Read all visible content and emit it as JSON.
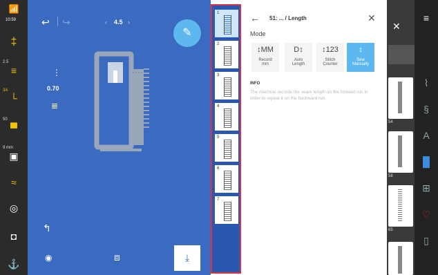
{
  "status": {
    "time": "10:59"
  },
  "left_settings": [
    {
      "label": "",
      "icon": "needle-icon"
    },
    {
      "label": "2.5",
      "icon": "stitch-width-icon"
    },
    {
      "label": "3A",
      "icon": "tension-icon"
    },
    {
      "label": "50",
      "icon": "presser-foot-pressure-icon"
    },
    {
      "label": "9 mm",
      "icon": "stitch-plate-icon"
    },
    {
      "label": "",
      "icon": "feed-dog-icon"
    },
    {
      "label": "",
      "icon": "bobbin-icon"
    },
    {
      "label": "",
      "icon": "presser-foot-icon"
    },
    {
      "label": "",
      "icon": "needle-stop-icon"
    }
  ],
  "canvas": {
    "undo_icon": "undo-icon",
    "redo_icon": "redo-icon",
    "stitch_length": "4.5",
    "side_value": "0.70",
    "edit_icon": "pencil-icon",
    "bottom_icons": [
      "eye-icon",
      "layers-icon",
      "download-icon"
    ]
  },
  "stitch_strip": [
    {
      "num": "1",
      "selected": true
    },
    {
      "num": "2",
      "selected": false
    },
    {
      "num": "3",
      "selected": false
    },
    {
      "num": "4",
      "selected": false
    },
    {
      "num": "5",
      "selected": false
    },
    {
      "num": "6",
      "selected": false
    },
    {
      "num": "7",
      "selected": false
    }
  ],
  "panel": {
    "title": "51: ... / Length",
    "mode_label": "Mode",
    "modes": [
      {
        "line1": "Record",
        "line2": "mm",
        "icon_text": "↕MM"
      },
      {
        "line1": "Auto",
        "line2": "Length",
        "icon_text": "D↕"
      },
      {
        "line1": "Stitch",
        "line2": "Counter",
        "icon_text": "↕123"
      },
      {
        "line1": "Sew",
        "line2": "Manually",
        "icon_text": "↕"
      }
    ],
    "info_heading": "INFO",
    "info_text": "The machine records the seam length on the forward run in order to repeat it on the backward run."
  },
  "right_cards": [
    "54",
    "58",
    "65"
  ],
  "right_nav_icons": [
    "menu-icon",
    "pattern-icon",
    "decorative-icon",
    "alphabet-icon",
    "buttonhole-icon",
    "quilt-icon",
    "heart-icon",
    "bottle-icon"
  ],
  "colors": {
    "canvas_blue": "#3b6bc1",
    "accent": "#5cb8ee",
    "selected_border": "#d8343f"
  }
}
